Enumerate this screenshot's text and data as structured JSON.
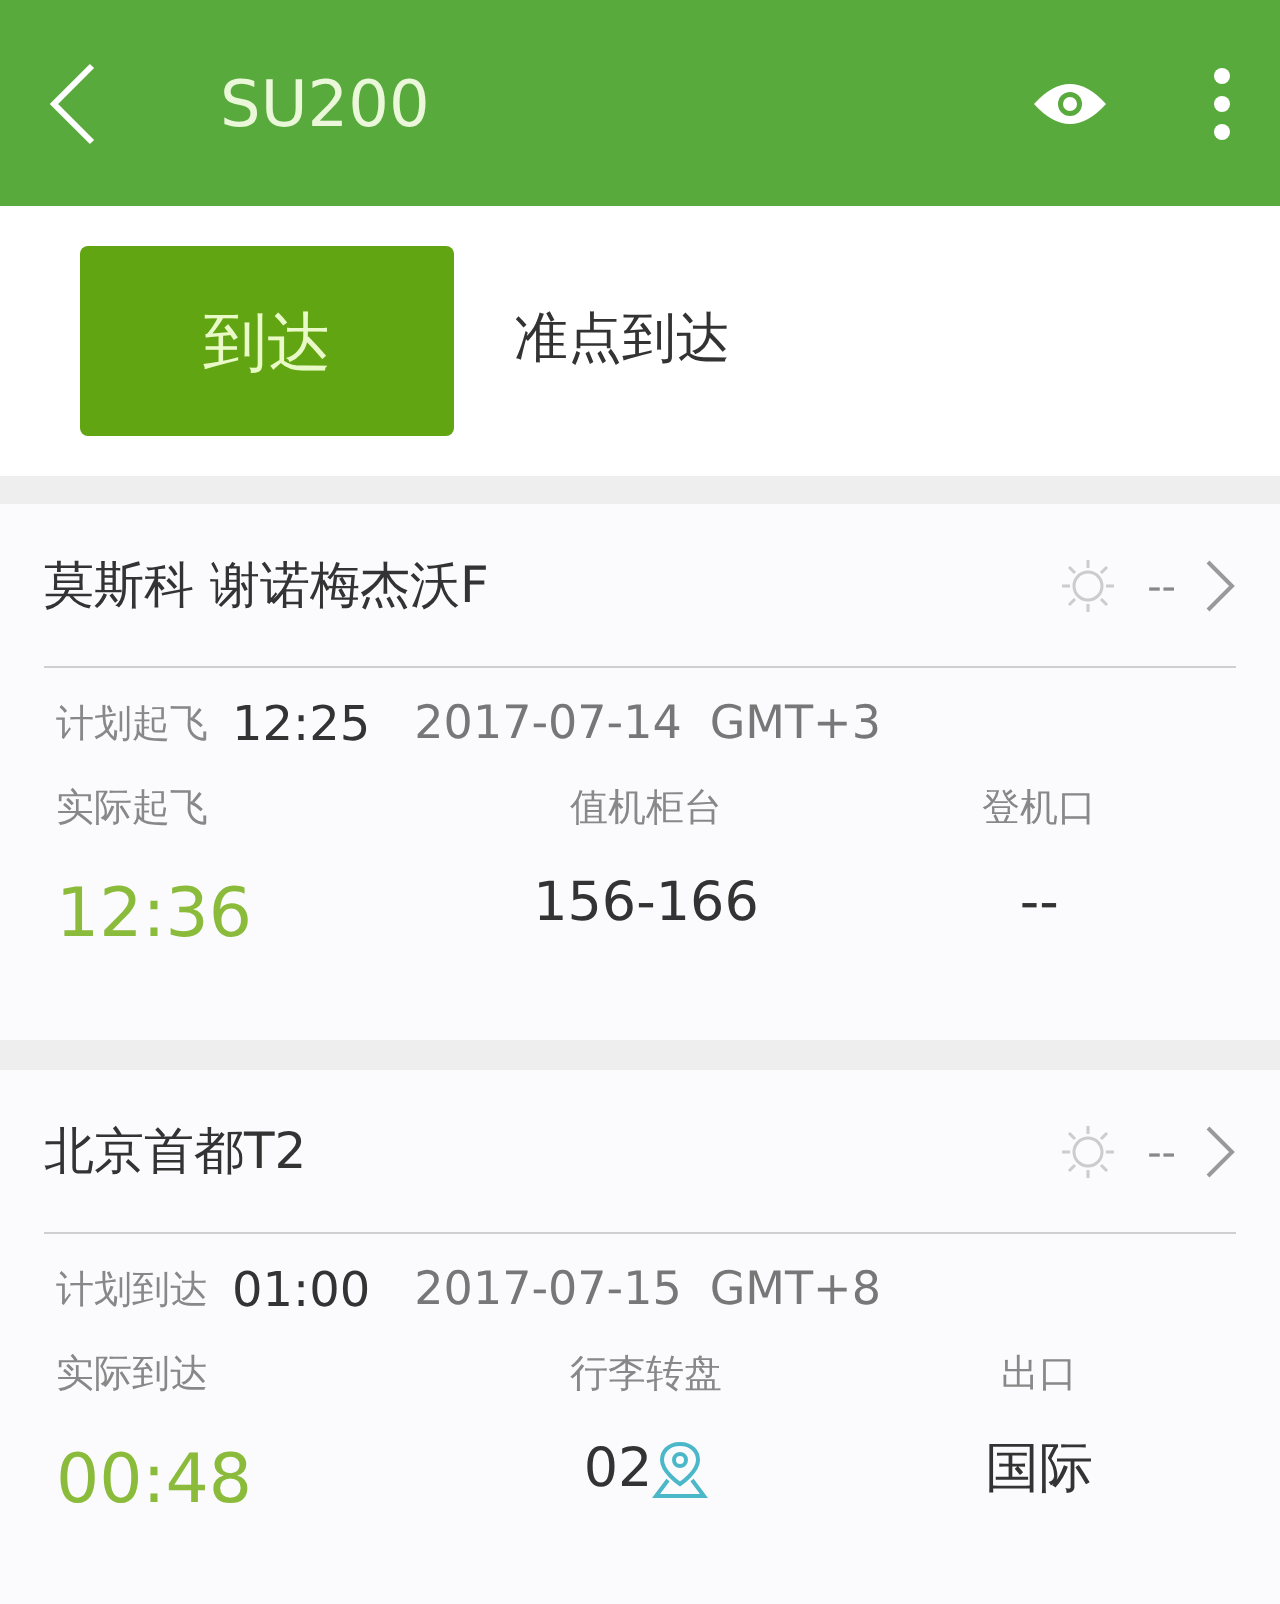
{
  "app_bar": {
    "title": "SU200"
  },
  "tabs": [
    {
      "label": "到达",
      "selected": true
    },
    {
      "label": "准点到达",
      "selected": false
    }
  ],
  "legs": [
    {
      "airport": "莫斯科 谢诺梅杰沃F",
      "weather": "--",
      "plan_label": "计划起飞",
      "plan_time": "12:25",
      "plan_date": "2017-07-14",
      "timezone": "GMT+3",
      "columns": [
        {
          "label": "实际起飞",
          "value": "12:36",
          "kind": "time"
        },
        {
          "label": "值机柜台",
          "value": "156-166",
          "kind": "plain"
        },
        {
          "label": "登机口",
          "value": "--",
          "kind": "plain"
        }
      ]
    },
    {
      "airport": "北京首都T2",
      "weather": "--",
      "plan_label": "计划到达",
      "plan_time": "01:00",
      "plan_date": "2017-07-15",
      "timezone": "GMT+8",
      "columns": [
        {
          "label": "实际到达",
          "value": "00:48",
          "kind": "time"
        },
        {
          "label": "行李转盘",
          "value": "02",
          "kind": "location"
        },
        {
          "label": "出口",
          "value": "国际",
          "kind": "plain"
        }
      ]
    }
  ]
}
